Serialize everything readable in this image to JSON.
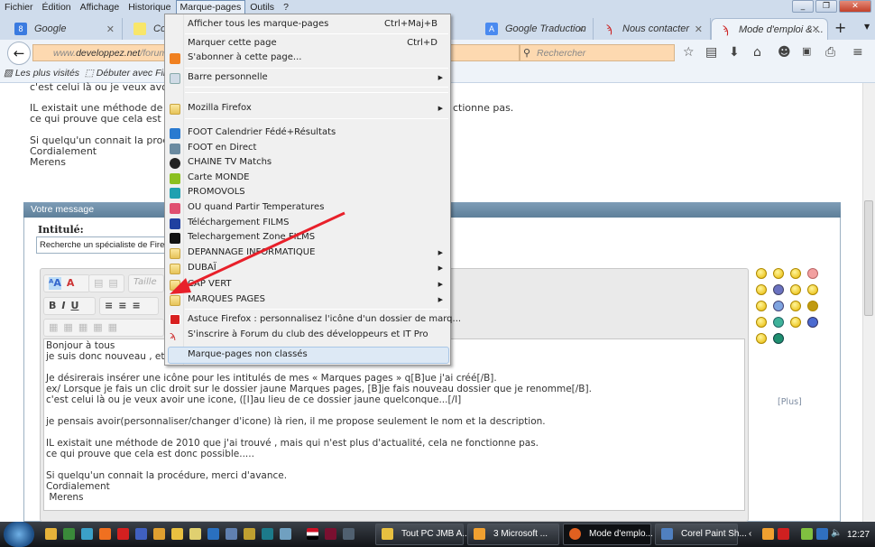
{
  "menubar": {
    "items": [
      "Fichier",
      "Édition",
      "Affichage",
      "Historique",
      "Marque-pages",
      "Outils",
      "?"
    ]
  },
  "tabs": [
    {
      "label": "Google",
      "icon": "google-icon"
    },
    {
      "label": "Com",
      "icon": "bulb-icon"
    },
    {
      "label": "Google Traduction",
      "icon": "google-translate-icon"
    },
    {
      "label": "Nous contacter",
      "icon": "developpez-icon"
    },
    {
      "label": "Mode d'emploi & ...",
      "icon": "developpez-icon",
      "active": true
    }
  ],
  "navbar": {
    "url_domain": "developpez.net",
    "url_prefix": "www.",
    "url_path": "/forums/new",
    "search_placeholder": "Rechercher"
  },
  "bookmarks_bar": {
    "items": [
      "Les plus visités",
      "Débuter avec Firefox"
    ]
  },
  "page": {
    "lines": [
      "c'est celui là ou je veux avoir",
      "IL existait une méthode de 20",
      "ce qui prouve que cela est do",
      "Si quelqu'un connait la procéd",
      "Cordialement",
      "Merens"
    ],
    "right_fragment": "ctionne pas.",
    "panel_title": "Votre message",
    "intitule_label": "Intitulé:",
    "intitule_value": "Recherche un spécialiste de Firefox/ic",
    "size_select": "Taille",
    "editor_text": "Bonjour à tous\nje suis donc nouveau , et                                                               s.\n\nJe désirerais insérer une icône pour les intitulés de mes « Marques pages » q[B]ue j'ai créé[/B].\nex/ Lorsque je fais un clic droit sur le dossier jaune Marques pages, [B]je fais nouveau dossier que je renomme[/B].\nc'est celui là ou je veux avoir une icone, ([I]au lieu de ce dossier jaune quelconque...[/I]\n\nje pensais avoir(personnaliser/changer d'icone) là rien, il me propose seulement le nom et la description.\n\nIL existait une méthode de 2010 que j'ai trouvé , mais qui n'est plus d'actualité, cela ne fonctionne pas.\nce qui prouve que cela est donc possible.....\n\nSi quelqu'un connait la procédure, merci d'avance.\nCordialement\n Merens",
    "smileys_more": "[Plus]"
  },
  "bookmarks_menu": {
    "items": [
      {
        "label": "Afficher tous les marque-pages",
        "shortcut": "Ctrl+Maj+B"
      },
      {
        "label": "Marquer cette page",
        "shortcut": "Ctrl+D"
      },
      {
        "label": "S'abonner à cette page...",
        "icon": "rss-icon"
      },
      {
        "label": "Barre personnelle",
        "submenu": true
      },
      {
        "label": "Mozilla Firefox",
        "submenu": true,
        "icon": "folder-icon"
      },
      {
        "label": "FOOT Calendrier Fédé+Résultats"
      },
      {
        "label": "FOOT en Direct"
      },
      {
        "label": "CHAINE TV Matchs"
      },
      {
        "label": "Carte MONDE"
      },
      {
        "label": "PROMOVOLS"
      },
      {
        "label": "OU quand Partir Temperatures"
      },
      {
        "label": "Téléchargement FILMS"
      },
      {
        "label": "Telechargement Zone FILMS"
      },
      {
        "label": "DEPANNAGE INFORMATIQUE",
        "submenu": true,
        "icon": "folder-icon"
      },
      {
        "label": "DUBAÏ",
        "submenu": true,
        "icon": "folder-icon"
      },
      {
        "label": "CAP VERT",
        "submenu": true,
        "icon": "folder-icon"
      },
      {
        "label": "MARQUES PAGES",
        "submenu": true,
        "icon": "folder-icon"
      },
      {
        "label": "Astuce Firefox : personnalisez l'icône d'un dossier de marq..."
      },
      {
        "label": "S'inscrire à Forum du club des développeurs et IT Pro"
      },
      {
        "label": "Marque-pages non classés",
        "highlighted": true
      }
    ]
  },
  "taskbar": {
    "tasks": [
      "Tout PC JMB A...",
      "3 Microsoft ...",
      "Mode d'emplo...",
      "Corel Paint Sh..."
    ],
    "clock": "12:27"
  },
  "colors": {
    "annotation_arrow": "#e8202a",
    "menubar_bg": "#cfdcec",
    "url_bg": "#fdd9b0"
  }
}
